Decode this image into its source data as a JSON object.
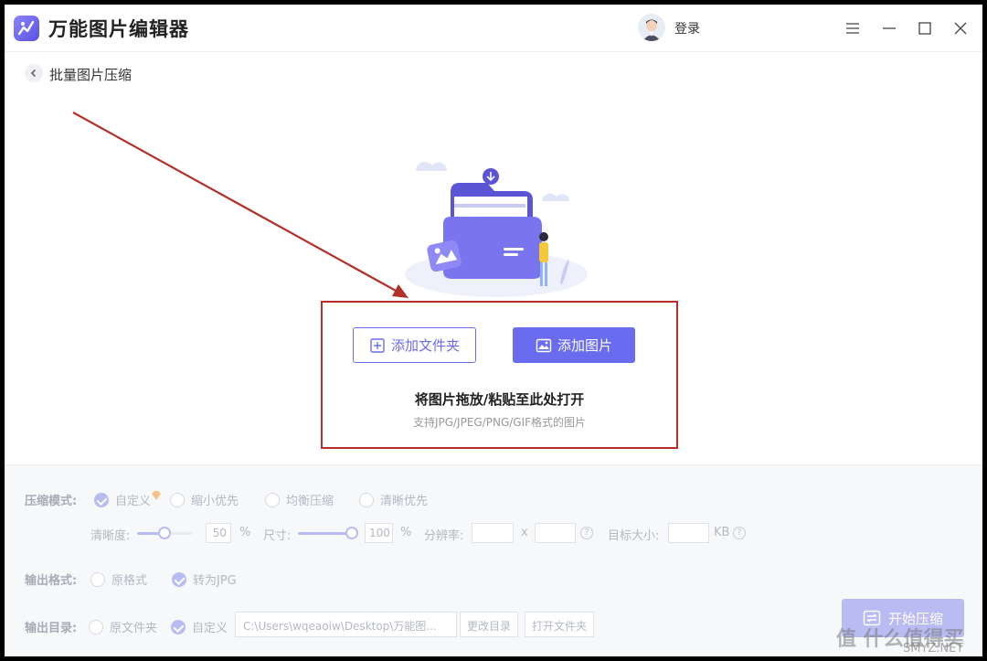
{
  "app": {
    "title": "万能图片编辑器",
    "login_label": "登录"
  },
  "page": {
    "title": "批量图片压缩"
  },
  "upload": {
    "add_folder_label": "添加文件夹",
    "add_image_label": "添加图片",
    "drop_title": "将图片拖放/粘贴至此处打开",
    "drop_subtitle": "支持JPG/JPEG/PNG/GIF格式的图片"
  },
  "settings": {
    "compress_mode_label": "压缩模式:",
    "modes": [
      "自定义",
      "缩小优先",
      "均衡压缩",
      "清晰优先"
    ],
    "clarity_label": "清晰度:",
    "clarity_value": "50",
    "size_label": "尺寸:",
    "size_value": "100",
    "percent": "%",
    "resolution_label": "分辨率:",
    "resolution_x": "x",
    "target_size_label": "目标大小:",
    "kb_unit": "KB",
    "output_format_label": "输出格式:",
    "formats": [
      "原格式",
      "转为JPG"
    ],
    "output_dir_label": "输出目录:",
    "dirs": [
      "原文件夹",
      "自定义"
    ],
    "path_value": "C:\\Users\\wqeaoiw\\Desktop\\万能图...",
    "change_dir_label": "更改目录",
    "open_folder_label": "打开文件夹",
    "start_label": "开始压缩"
  },
  "watermark": {
    "text": "值 什么值得买",
    "sub": "SMYZ.NET"
  },
  "colors": {
    "accent": "#6a6cf0",
    "accent_disabled": "#b9bcf3",
    "highlight_box": "#b3302a"
  }
}
